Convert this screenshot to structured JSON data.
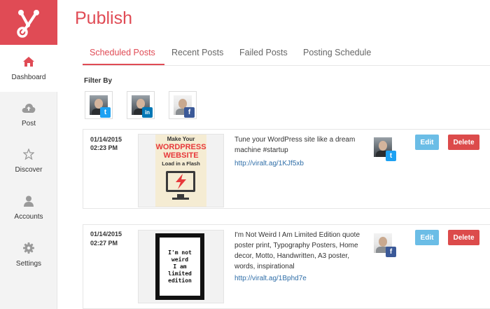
{
  "app": {
    "logo_icon": "share-nodes-logo-icon",
    "brand_color": "#e04b55"
  },
  "sidebar": {
    "items": [
      {
        "label": "Dashboard",
        "icon": "home-icon",
        "active": true
      },
      {
        "label": "Post",
        "icon": "cloud-upload-icon"
      },
      {
        "label": "Discover",
        "icon": "star-icon"
      },
      {
        "label": "Accounts",
        "icon": "user-icon"
      },
      {
        "label": "Settings",
        "icon": "gear-icon"
      }
    ]
  },
  "header": {
    "title": "Publish"
  },
  "tabs": [
    {
      "label": "Scheduled Posts",
      "active": true
    },
    {
      "label": "Recent Posts"
    },
    {
      "label": "Failed Posts"
    },
    {
      "label": "Posting Schedule"
    }
  ],
  "filter": {
    "label": "Filter By",
    "accounts": [
      {
        "network": "twitter",
        "badge": "t"
      },
      {
        "network": "linkedin",
        "badge": "in"
      },
      {
        "network": "facebook",
        "badge": "f"
      }
    ]
  },
  "posts": [
    {
      "date": "01/14/2015",
      "time": "02:23 PM",
      "text": "Tune your WordPress site like a dream machine #startup",
      "link": "http://viralt.ag/1KJf5xb",
      "network": "twitter",
      "badge": "t",
      "thumb_text": {
        "line1": "Make Your",
        "line2": "WordPress",
        "line3": "Website",
        "line4": "Load in a Flash"
      }
    },
    {
      "date": "01/14/2015",
      "time": "02:27 PM",
      "text": "I'm Not Weird I Am Limited Edition quote poster print, Typography Posters, Home decor, Motto, Handwritten, A3 poster, words, inspirational",
      "link": "http://viralt.ag/1Bphd7e",
      "network": "facebook",
      "badge": "f",
      "thumb_text": {
        "line1": "I'm not",
        "line2": "weird",
        "line3": "I am",
        "line4": "limited",
        "line5": "edition"
      }
    }
  ],
  "buttons": {
    "edit": "Edit",
    "delete": "Delete"
  }
}
